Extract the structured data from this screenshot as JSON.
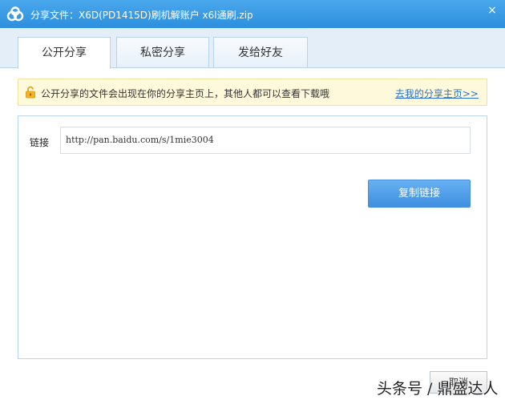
{
  "window": {
    "title": "分享文件：X6D(PD1415D)刷机解账户 x6l通刷.zip",
    "close_glyph": "×",
    "logo_icon": "baidu-cloud-icon"
  },
  "tabs": [
    {
      "label": "公开分享",
      "active": true
    },
    {
      "label": "私密分享",
      "active": false
    },
    {
      "label": "发给好友",
      "active": false
    }
  ],
  "notice": {
    "icon": "unlock-icon",
    "text": "公开分享的文件会出现在你的分享主页上，其他人都可以查看下载哦",
    "link": "去我的分享主页>>"
  },
  "share": {
    "link_label": "链接",
    "link_value": "http://pan.baidu.com/s/1mie3004",
    "copy_button": "复制链接"
  },
  "footer": {
    "button_label": "取消",
    "watermark": "头条号 / 鼎盛达人"
  },
  "colors": {
    "titlebar": "#3a9be6",
    "accent": "#3e8fe0",
    "link": "#2a72c6",
    "notice_bg": "#fff9db"
  }
}
